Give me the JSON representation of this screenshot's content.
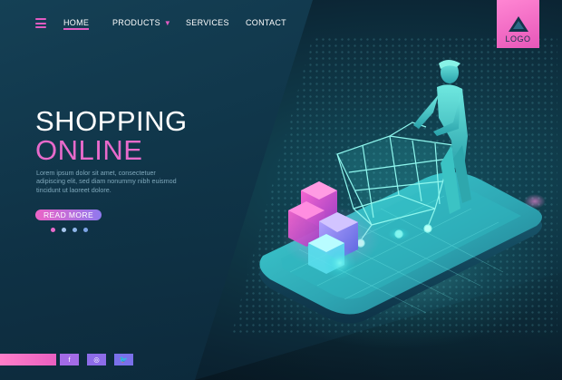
{
  "nav": {
    "items": [
      {
        "label": "HOME",
        "active": true
      },
      {
        "label": "PRODUCTS",
        "dropdown": true
      },
      {
        "label": "SERVICES"
      },
      {
        "label": "CONTACT"
      }
    ],
    "caret_icon": "caret-down-icon"
  },
  "logo": {
    "text": "LOGO",
    "icon": "triangle-logo-icon"
  },
  "hero": {
    "title": "SHOPPING",
    "subtitle": "ONLINE",
    "body": "Lorem ipsum dolor sit amet, consectetuer adipiscing elit, sed diam nonummy nibh euismod tincidunt ut laoreet dolore.",
    "cta_label": "READ MORE"
  },
  "pager": {
    "count": 4,
    "active_index": 0
  },
  "social": [
    {
      "label": "f",
      "icon": "facebook-icon"
    },
    {
      "label": "◎",
      "icon": "instagram-icon"
    },
    {
      "label": "🐦",
      "icon": "twitter-icon"
    }
  ],
  "colors": {
    "accent_pink": "#e25bc2",
    "accent_purple": "#8f79ee",
    "accent_teal": "#35e3e0",
    "background": "#0d2b3b"
  },
  "illustration": {
    "subject": "person pushing shopping cart on smartphone with boxes",
    "icons": [
      "smartphone-icon",
      "shopping-cart-icon",
      "person-icon",
      "boxes-icon"
    ]
  }
}
